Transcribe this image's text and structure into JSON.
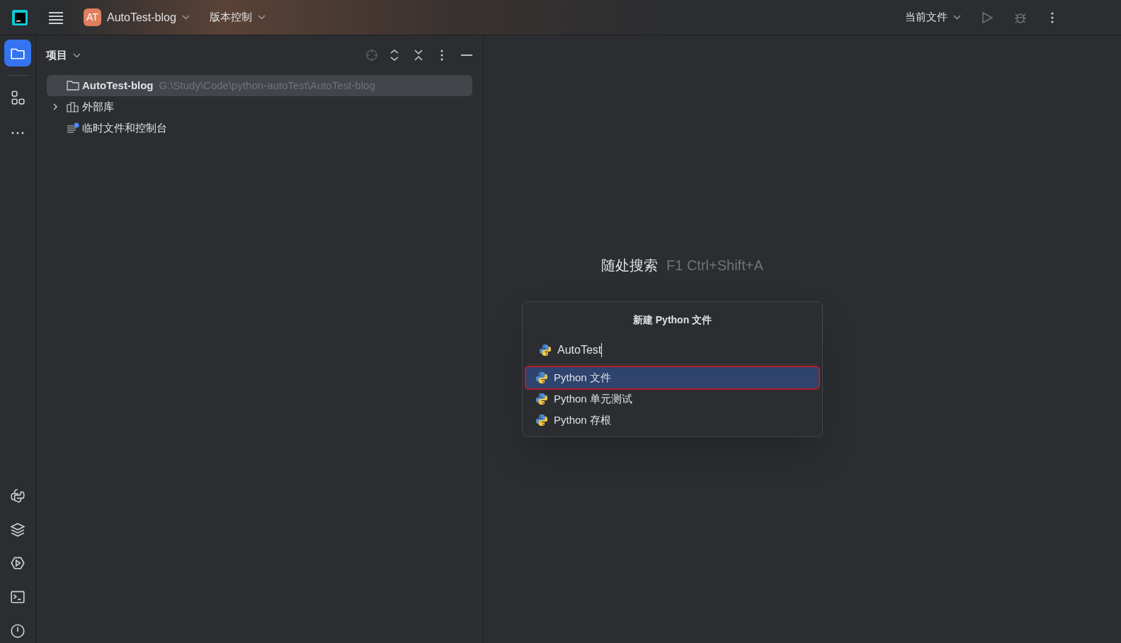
{
  "toolbar": {
    "project_badge": "AT",
    "project_name": "AutoTest-blog",
    "vcs_menu": "版本控制",
    "run_config": "当前文件"
  },
  "tool_stripe": {
    "top": [
      {
        "kind": "project",
        "selected": true
      },
      {
        "kind": "structure",
        "selected": false
      },
      {
        "kind": "more",
        "selected": false
      }
    ],
    "bottom": [
      {
        "kind": "python-console",
        "selected": false
      },
      {
        "kind": "layers",
        "selected": false
      },
      {
        "kind": "services",
        "selected": false
      },
      {
        "kind": "terminal",
        "selected": false
      },
      {
        "kind": "problems",
        "selected": false
      }
    ]
  },
  "project_panel": {
    "title": "项目",
    "tree": [
      {
        "kind": "folder",
        "label": "AutoTest-blog",
        "path": "G:\\Study\\Code\\python-autoTest\\AutoTest-blog",
        "selected": true
      },
      {
        "kind": "library",
        "label": "外部库",
        "expanded": false,
        "selected": false
      },
      {
        "kind": "scratch",
        "label": "临时文件和控制台",
        "selected": false
      }
    ]
  },
  "editor_hints": [
    {
      "label": "随处搜索",
      "shortcut": "F1 Ctrl+Shift+A"
    }
  ],
  "new_file_popup": {
    "title": "新建 Python 文件",
    "value": "AutoTest",
    "options": [
      {
        "label": "Python 文件",
        "selected": true
      },
      {
        "label": "Python 单元测试",
        "selected": false
      },
      {
        "label": "Python 存根",
        "selected": false
      }
    ]
  }
}
